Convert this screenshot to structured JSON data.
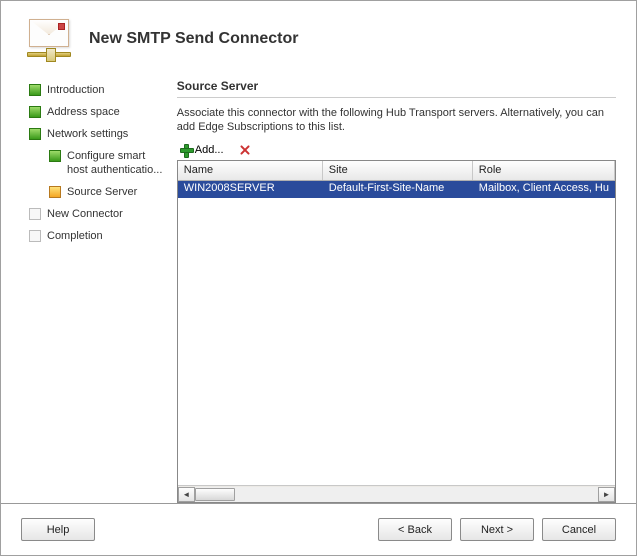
{
  "header": {
    "title": "New SMTP Send Connector"
  },
  "sidebar": {
    "items": [
      {
        "label": "Introduction",
        "state": "done"
      },
      {
        "label": "Address space",
        "state": "done"
      },
      {
        "label": "Network settings",
        "state": "done"
      },
      {
        "label": "Configure smart host authenticatio...",
        "state": "done",
        "sub": true
      },
      {
        "label": "Source Server",
        "state": "active",
        "sub": true
      },
      {
        "label": "New Connector",
        "state": "pending"
      },
      {
        "label": "Completion",
        "state": "pending"
      }
    ]
  },
  "content": {
    "section_title": "Source Server",
    "description": "Associate this connector with the following Hub Transport servers. Alternatively, you can add Edge Subscriptions to this list.",
    "toolbar": {
      "add_label": "Add..."
    },
    "grid": {
      "columns": {
        "name": "Name",
        "site": "Site",
        "role": "Role"
      },
      "rows": [
        {
          "name": "WIN2008SERVER",
          "site": "Default-First-Site-Name",
          "role": "Mailbox, Client Access, Hu"
        }
      ]
    }
  },
  "footer": {
    "help": "Help",
    "back": "< Back",
    "next": "Next >",
    "cancel": "Cancel"
  }
}
